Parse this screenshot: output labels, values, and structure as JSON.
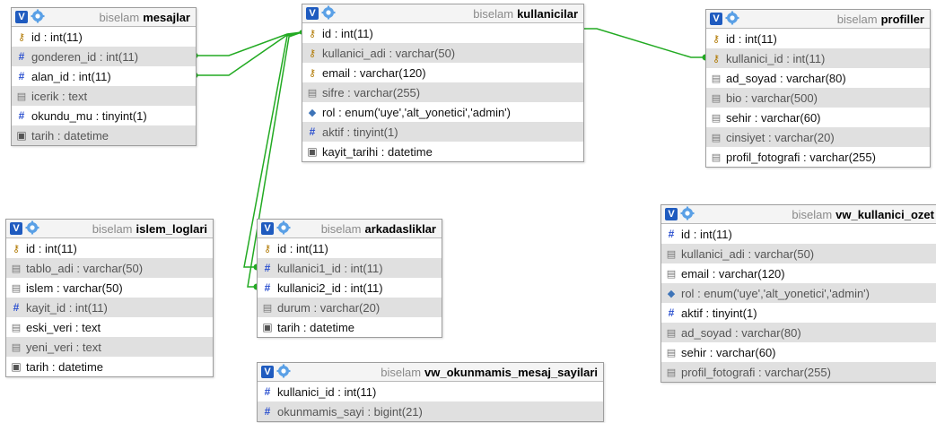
{
  "schema": "biselam",
  "badge": "V",
  "colors": {
    "line": "#22aa22",
    "badge": "#1f5bbf",
    "header_bg": "#f4f4f4",
    "alt_row": "#e0e0e0"
  },
  "tables": [
    {
      "id": "mesajlar",
      "name": "mesajlar",
      "columns": [
        {
          "name": "id",
          "type": "int(11)",
          "icon": "key-icon"
        },
        {
          "name": "gonderen_id",
          "type": "int(11)",
          "icon": "hash-icon"
        },
        {
          "name": "alan_id",
          "type": "int(11)",
          "icon": "hash-icon"
        },
        {
          "name": "icerik",
          "type": "text",
          "icon": "text-icon"
        },
        {
          "name": "okundu_mu",
          "type": "tinyint(1)",
          "icon": "hash-icon"
        },
        {
          "name": "tarih",
          "type": "datetime",
          "icon": "calendar-icon"
        }
      ]
    },
    {
      "id": "kullanicilar",
      "name": "kullanicilar",
      "columns": [
        {
          "name": "id",
          "type": "int(11)",
          "icon": "key-icon"
        },
        {
          "name": "kullanici_adi",
          "type": "varchar(50)",
          "icon": "key-icon"
        },
        {
          "name": "email",
          "type": "varchar(120)",
          "icon": "key-icon"
        },
        {
          "name": "sifre",
          "type": "varchar(255)",
          "icon": "text-icon"
        },
        {
          "name": "rol",
          "type": "enum('uye','alt_yonetici','admin')",
          "icon": "enum-icon"
        },
        {
          "name": "aktif",
          "type": "tinyint(1)",
          "icon": "hash-icon"
        },
        {
          "name": "kayit_tarihi",
          "type": "datetime",
          "icon": "calendar-icon"
        }
      ]
    },
    {
      "id": "profiller",
      "name": "profiller",
      "columns": [
        {
          "name": "id",
          "type": "int(11)",
          "icon": "key-icon"
        },
        {
          "name": "kullanici_id",
          "type": "int(11)",
          "icon": "key-icon"
        },
        {
          "name": "ad_soyad",
          "type": "varchar(80)",
          "icon": "text-icon"
        },
        {
          "name": "bio",
          "type": "varchar(500)",
          "icon": "text-icon"
        },
        {
          "name": "sehir",
          "type": "varchar(60)",
          "icon": "text-icon"
        },
        {
          "name": "cinsiyet",
          "type": "varchar(20)",
          "icon": "text-icon"
        },
        {
          "name": "profil_fotografi",
          "type": "varchar(255)",
          "icon": "text-icon"
        }
      ]
    },
    {
      "id": "islem_loglari",
      "name": "islem_loglari",
      "columns": [
        {
          "name": "id",
          "type": "int(11)",
          "icon": "key-icon"
        },
        {
          "name": "tablo_adi",
          "type": "varchar(50)",
          "icon": "text-icon"
        },
        {
          "name": "islem",
          "type": "varchar(50)",
          "icon": "text-icon"
        },
        {
          "name": "kayit_id",
          "type": "int(11)",
          "icon": "hash-icon"
        },
        {
          "name": "eski_veri",
          "type": "text",
          "icon": "text-icon"
        },
        {
          "name": "yeni_veri",
          "type": "text",
          "icon": "text-icon"
        },
        {
          "name": "tarih",
          "type": "datetime",
          "icon": "calendar-icon"
        }
      ]
    },
    {
      "id": "arkadasliklar",
      "name": "arkadasliklar",
      "columns": [
        {
          "name": "id",
          "type": "int(11)",
          "icon": "key-icon"
        },
        {
          "name": "kullanici1_id",
          "type": "int(11)",
          "icon": "hash-icon"
        },
        {
          "name": "kullanici2_id",
          "type": "int(11)",
          "icon": "hash-icon"
        },
        {
          "name": "durum",
          "type": "varchar(20)",
          "icon": "text-icon"
        },
        {
          "name": "tarih",
          "type": "datetime",
          "icon": "calendar-icon"
        }
      ]
    },
    {
      "id": "vw_kullanici_ozet",
      "name": "vw_kullanici_ozet",
      "columns": [
        {
          "name": "id",
          "type": "int(11)",
          "icon": "hash-icon"
        },
        {
          "name": "kullanici_adi",
          "type": "varchar(50)",
          "icon": "text-icon"
        },
        {
          "name": "email",
          "type": "varchar(120)",
          "icon": "text-icon"
        },
        {
          "name": "rol",
          "type": "enum('uye','alt_yonetici','admin')",
          "icon": "enum-icon"
        },
        {
          "name": "aktif",
          "type": "tinyint(1)",
          "icon": "hash-icon"
        },
        {
          "name": "ad_soyad",
          "type": "varchar(80)",
          "icon": "text-icon"
        },
        {
          "name": "sehir",
          "type": "varchar(60)",
          "icon": "text-icon"
        },
        {
          "name": "profil_fotografi",
          "type": "varchar(255)",
          "icon": "text-icon"
        }
      ]
    },
    {
      "id": "vw_okunmamis_mesaj_sayilari",
      "name": "vw_okunmamis_mesaj_sayilari",
      "columns": [
        {
          "name": "kullanici_id",
          "type": "int(11)",
          "icon": "hash-icon"
        },
        {
          "name": "okunmamis_sayi",
          "type": "bigint(21)",
          "icon": "hash-icon"
        }
      ]
    }
  ]
}
